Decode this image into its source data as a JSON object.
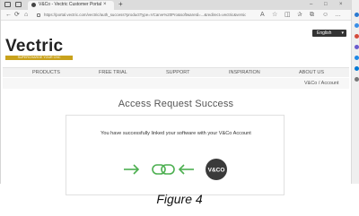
{
  "browser": {
    "tab_title": "V&Co - Vectric Customer Portal",
    "tab_close": "×",
    "new_tab": "+",
    "url": "https://portal.vectric.com/vectric/auth_success?productType=VCarve%20Pro&softwareId=...&redirect=vectric&version=12",
    "window_minimize": "–",
    "window_maximize": "□",
    "window_close": "×"
  },
  "site": {
    "logo_text": "Vectric",
    "logo_tagline": "SUPERCHARGE YOUR CNC",
    "language": "English",
    "language_caret": "▾",
    "nav": [
      "PRODUCTS",
      "FREE TRIAL",
      "SUPPORT",
      "INSPIRATION",
      "ABOUT US"
    ],
    "breadcrumb": "V&Co / Account"
  },
  "main": {
    "heading": "Access Request Success",
    "message": "You have successfully linked your software with your V&Co Account",
    "vco_badge": "V&CO"
  },
  "caption": "Figure 4",
  "colors": {
    "accent_green": "#4caf50",
    "brand_gold": "#c9a21c",
    "dark_badge": "#3a3a3a"
  }
}
